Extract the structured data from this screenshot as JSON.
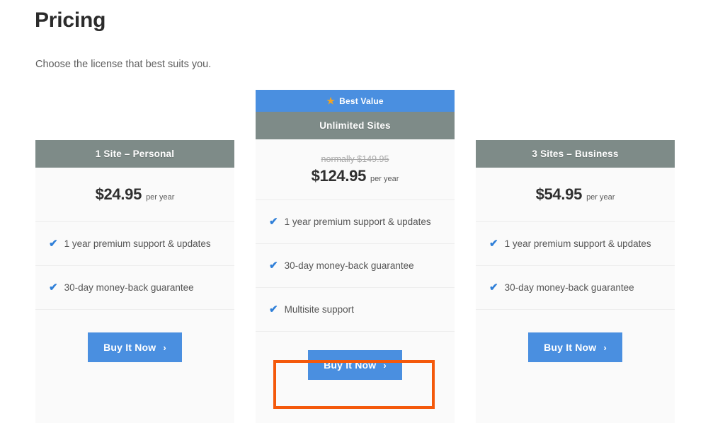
{
  "page": {
    "title": "Pricing",
    "subtitle": "Choose the license that best suits you."
  },
  "colors": {
    "accent_blue": "#4a8fe0",
    "header_gray": "#7e8b88",
    "star_orange": "#f0a324",
    "check_blue": "#2f7fd8",
    "highlight_orange": "#f4590b",
    "card_background": "#fafafa"
  },
  "cards": [
    {
      "id": "personal",
      "featured": false,
      "banner": null,
      "header": "1 Site – Personal",
      "price_old": null,
      "price": "$24.95",
      "price_period": "per year",
      "features": [
        "1 year premium support & updates",
        "30-day money-back guarantee"
      ],
      "cta": "Buy It Now"
    },
    {
      "id": "unlimited",
      "featured": true,
      "banner": "Best Value",
      "banner_icon": "star-icon",
      "header": "Unlimited Sites",
      "price_old": "normally $149.95",
      "price": "$124.95",
      "price_period": "per year",
      "features": [
        "1 year premium support & updates",
        "30-day money-back guarantee",
        "Multisite support"
      ],
      "cta": "Buy It Now"
    },
    {
      "id": "business",
      "featured": false,
      "banner": null,
      "header": "3 Sites – Business",
      "price_old": null,
      "price": "$54.95",
      "price_period": "per year",
      "features": [
        "1 year premium support & updates",
        "30-day money-back guarantee"
      ],
      "cta": "Buy It Now"
    }
  ],
  "icons": {
    "star": "★",
    "check": "✔",
    "arrow": "›"
  }
}
